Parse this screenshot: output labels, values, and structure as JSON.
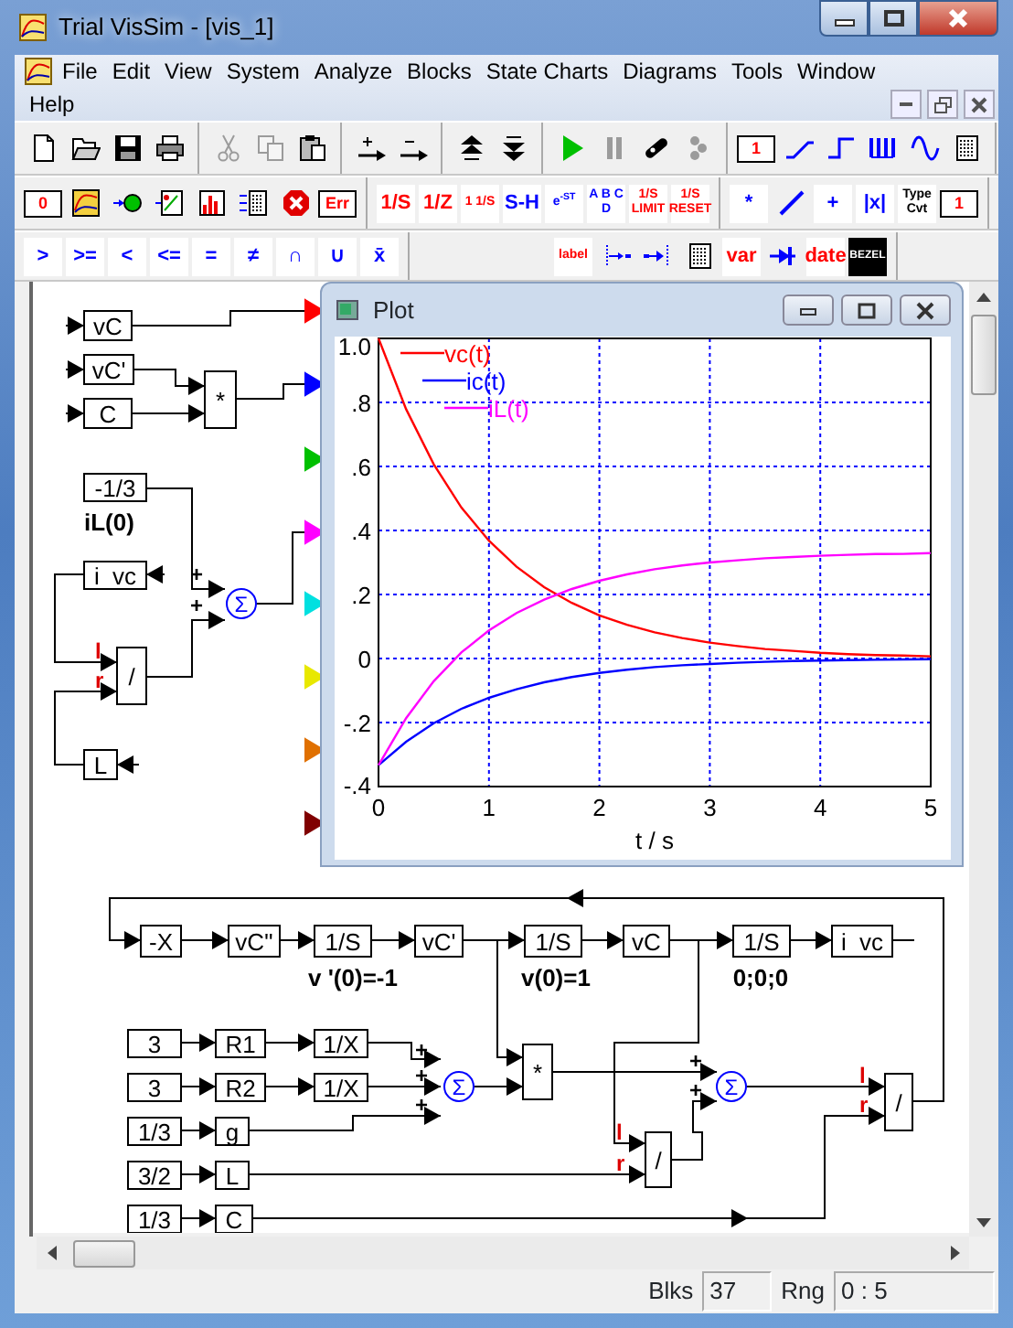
{
  "window": {
    "title": "Trial VisSim - [vis_1]"
  },
  "menu": [
    "File",
    "Edit",
    "View",
    "System",
    "Analyze",
    "Blocks",
    "State Charts",
    "Diagrams",
    "Tools",
    "Window",
    "Help"
  ],
  "toolbars": [
    {
      "groups": [
        [
          {
            "kind": "icon",
            "disabled": false
          },
          {
            "kind": "icon",
            "disabled": false
          },
          {
            "kind": "icon",
            "disabled": false
          },
          {
            "kind": "icon",
            "disabled": false
          }
        ],
        [
          {
            "kind": "icon",
            "disabled": true
          },
          {
            "kind": "icon",
            "disabled": true
          },
          {
            "kind": "icon",
            "disabled": false
          }
        ],
        [
          {
            "kind": "icon",
            "disabled": false
          },
          {
            "kind": "icon",
            "disabled": false
          }
        ],
        [
          {
            "kind": "icon",
            "disabled": false
          },
          {
            "kind": "icon",
            "disabled": false
          }
        ],
        [
          {
            "kind": "icon",
            "disabled": false
          },
          {
            "kind": "icon",
            "disabled": true
          },
          {
            "kind": "icon",
            "disabled": false
          },
          {
            "kind": "icon",
            "disabled": true
          }
        ],
        [
          {
            "kind": "block",
            "label": "1",
            "color": "#ff0000",
            "disabled": false
          },
          {
            "kind": "icon",
            "disabled": false
          },
          {
            "kind": "icon",
            "disabled": false
          },
          {
            "kind": "icon",
            "disabled": false
          },
          {
            "kind": "icon",
            "disabled": false
          },
          {
            "kind": "icon",
            "disabled": false
          }
        ]
      ]
    },
    {
      "groups": [
        [
          {
            "kind": "block",
            "label": "0",
            "color": "#ff0000",
            "disabled": false
          },
          {
            "kind": "icon",
            "disabled": false
          },
          {
            "kind": "icon",
            "disabled": false
          },
          {
            "kind": "icon",
            "disabled": false
          },
          {
            "kind": "icon",
            "disabled": false
          },
          {
            "kind": "icon",
            "disabled": false
          },
          {
            "kind": "icon",
            "disabled": false
          },
          {
            "kind": "block",
            "label": "Err",
            "color": "#ff0000",
            "disabled": false
          }
        ],
        [
          {
            "kind": "text",
            "label": "1/S",
            "color": "#ff0000",
            "disabled": false
          },
          {
            "kind": "text",
            "label": "1/Z",
            "color": "#ff0000",
            "disabled": false
          },
          {
            "kind": "text",
            "label": "1 1/S",
            "color": "#ff0000",
            "disabled": false
          },
          {
            "kind": "text",
            "label": "S-H",
            "color": "#0000ff",
            "disabled": false
          },
          {
            "kind": "text",
            "label": "e$^{-ST}$",
            "color": "#0000ff",
            "disabled": false
          },
          {
            "kind": "text",
            "label": "A B C D",
            "color": "#0000ff",
            "disabled": false
          },
          {
            "kind": "text",
            "label": "1/S LIMIT",
            "color": "#ff0000",
            "disabled": false
          },
          {
            "kind": "text",
            "label": "1/S RESET",
            "color": "#ff0000",
            "disabled": false
          }
        ],
        [
          {
            "kind": "text",
            "label": "*",
            "color": "#0000ff",
            "disabled": false
          },
          {
            "kind": "icon",
            "disabled": false
          },
          {
            "kind": "text",
            "label": "+",
            "color": "#0000ff",
            "disabled": false
          },
          {
            "kind": "text",
            "label": "|x|",
            "color": "#0000ff",
            "disabled": false
          },
          {
            "kind": "text",
            "label": "Type Cvt",
            "color": "#000000",
            "disabled": false
          },
          {
            "kind": "block",
            "label": "1",
            "color": "#ff0000",
            "disabled": false
          }
        ]
      ]
    },
    {
      "groups": [
        [
          {
            "kind": "text",
            "label": ">",
            "color": "#0000ff",
            "disabled": false
          },
          {
            "kind": "text",
            "label": ">=",
            "color": "#0000ff",
            "disabled": false
          },
          {
            "kind": "text",
            "label": "<",
            "color": "#0000ff",
            "disabled": false
          },
          {
            "kind": "text",
            "label": "<=",
            "color": "#0000ff",
            "disabled": false
          },
          {
            "kind": "text",
            "label": "=",
            "color": "#0000ff",
            "disabled": false
          },
          {
            "kind": "text",
            "label": "≠",
            "color": "#0000ff",
            "disabled": false
          },
          {
            "kind": "text",
            "label": "∩",
            "color": "#0000ff",
            "disabled": false
          },
          {
            "kind": "text",
            "label": "∪",
            "color": "#0000ff",
            "disabled": false
          },
          {
            "kind": "text",
            "label": "x̄",
            "color": "#0000ff",
            "disabled": false
          }
        ],
        [
          {
            "kind": "text",
            "label": "label",
            "color": "#ff0000",
            "disabled": false
          },
          {
            "kind": "icon",
            "disabled": false
          },
          {
            "kind": "icon",
            "disabled": false
          },
          {
            "kind": "icon",
            "disabled": false
          },
          {
            "kind": "text",
            "label": "var",
            "color": "#ff0000",
            "disabled": false
          },
          {
            "kind": "icon",
            "disabled": false
          },
          {
            "kind": "text",
            "label": "date",
            "color": "#ff0000",
            "disabled": false
          },
          {
            "kind": "badge",
            "label": "BEZEL",
            "color": "#000000",
            "disabled": false
          }
        ]
      ]
    }
  ],
  "diagram": {
    "blocks": [
      {
        "kind": "box",
        "label": "vC"
      },
      {
        "kind": "box",
        "label": "vC'"
      },
      {
        "kind": "box",
        "label": "C"
      },
      {
        "kind": "box",
        "label": "*"
      },
      {
        "kind": "box",
        "label": "-1/3"
      },
      {
        "kind": "box",
        "label": "i  vc"
      },
      {
        "kind": "sum",
        "label": "Σ"
      },
      {
        "kind": "box",
        "label": "/"
      },
      {
        "kind": "box",
        "label": "L"
      },
      {
        "kind": "box",
        "label": "-X"
      },
      {
        "kind": "box",
        "label": "vC''"
      },
      {
        "kind": "box",
        "label": "1/S"
      },
      {
        "kind": "box",
        "label": "vC'"
      },
      {
        "kind": "box",
        "label": "1/S"
      },
      {
        "kind": "box",
        "label": "vC"
      },
      {
        "kind": "box",
        "label": "1/S"
      },
      {
        "kind": "box",
        "label": "i  vc"
      },
      {
        "kind": "box",
        "label": "3"
      },
      {
        "kind": "box",
        "label": "R1"
      },
      {
        "kind": "box",
        "label": "1/X"
      },
      {
        "kind": "box",
        "label": "3"
      },
      {
        "kind": "box",
        "label": "R2"
      },
      {
        "kind": "box",
        "label": "1/X"
      },
      {
        "kind": "box",
        "label": "1/3"
      },
      {
        "kind": "box",
        "label": "g"
      },
      {
        "kind": "box",
        "label": "3/2"
      },
      {
        "kind": "box",
        "label": "L"
      },
      {
        "kind": "box",
        "label": "1/3"
      },
      {
        "kind": "box",
        "label": "C"
      },
      {
        "kind": "sum",
        "label": "Σ"
      },
      {
        "kind": "box",
        "label": "*"
      },
      {
        "kind": "box",
        "label": "/"
      },
      {
        "kind": "sum",
        "label": "Σ"
      },
      {
        "kind": "box",
        "label": "/"
      }
    ],
    "notes": [
      "iL(0)",
      "v '(0)=-1",
      "v(0)=1",
      "0;0;0"
    ],
    "signs": [
      "+",
      "+",
      "l",
      "r",
      "+",
      "+",
      "+",
      "l",
      "r",
      "+",
      "+",
      "l",
      "r"
    ],
    "ports": [
      {
        "color": "#ff0000"
      },
      {
        "color": "#0000ff"
      },
      {
        "color": "#00c000"
      },
      {
        "color": "#ff00ff"
      },
      {
        "color": "#00e0e0"
      },
      {
        "color": "#e8e800"
      },
      {
        "color": "#e07000"
      },
      {
        "color": "#800000"
      }
    ]
  },
  "plot": {
    "title": "Plot",
    "chart_data": {
      "type": "line",
      "xlabel": "t / s",
      "x": [
        0,
        0.25,
        0.5,
        0.75,
        1,
        1.25,
        1.5,
        1.75,
        2,
        2.25,
        2.5,
        2.75,
        3,
        3.25,
        3.5,
        3.75,
        4,
        4.25,
        4.5,
        4.75,
        5
      ],
      "series": [
        {
          "name": "vc(t)",
          "color": "#ff0000",
          "values": [
            1,
            0.779,
            0.607,
            0.472,
            0.368,
            0.287,
            0.223,
            0.174,
            0.135,
            0.105,
            0.082,
            0.064,
            0.05,
            0.039,
            0.03,
            0.024,
            0.018,
            0.014,
            0.011,
            0.009,
            0.007
          ]
        },
        {
          "name": "ic(t)",
          "color": "#0000ff",
          "values": [
            -0.333,
            -0.26,
            -0.202,
            -0.157,
            -0.123,
            -0.096,
            -0.074,
            -0.058,
            -0.045,
            -0.035,
            -0.027,
            -0.021,
            -0.017,
            -0.013,
            -0.01,
            -0.008,
            -0.006,
            -0.005,
            -0.004,
            -0.003,
            -0.002
          ]
        },
        {
          "name": "iL(t)",
          "color": "#ff00ff",
          "values": [
            -0.333,
            -0.186,
            -0.071,
            0.019,
            0.088,
            0.142,
            0.184,
            0.217,
            0.243,
            0.263,
            0.279,
            0.291,
            0.3,
            0.307,
            0.313,
            0.317,
            0.321,
            0.324,
            0.326,
            0.327,
            0.329
          ]
        }
      ],
      "xlim": [
        0,
        5
      ],
      "ylim": [
        -0.4,
        1.0
      ],
      "grid": true,
      "legend": true,
      "xticks": [
        0,
        1,
        2,
        3,
        4,
        5
      ],
      "yticks": [
        {
          "value": 1.0,
          "label": "1.0"
        },
        {
          "value": 0.8,
          "label": ".8"
        },
        {
          "value": 0.6,
          "label": ".6"
        },
        {
          "value": 0.4,
          "label": ".4"
        },
        {
          "value": 0.2,
          "label": ".2"
        },
        {
          "value": 0,
          "label": "0"
        },
        {
          "value": -0.2,
          "label": "-.2"
        },
        {
          "value": -0.4,
          "label": "-.4"
        }
      ]
    }
  },
  "status_bar": {
    "blocks_label": "Blks",
    "blocks_value": "37",
    "range_label": "Rng",
    "range_value": "0 : 5"
  }
}
